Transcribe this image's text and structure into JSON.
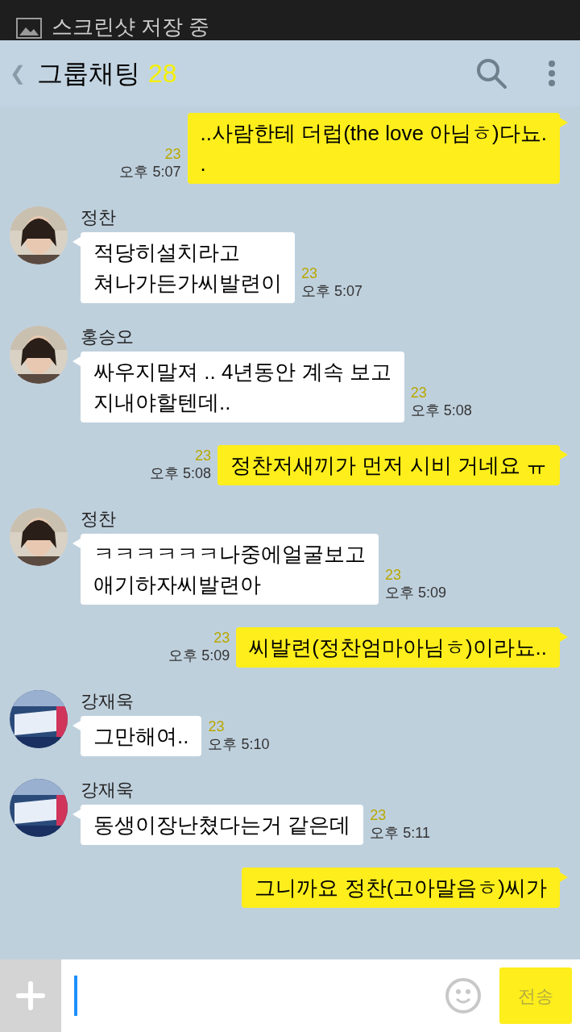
{
  "notification": {
    "text": "스크린샷 저장 중"
  },
  "header": {
    "back": "❮",
    "title": "그룹채팅",
    "member_count": "28"
  },
  "messages": [
    {
      "kind": "sent",
      "lines": [
        "..사람한테 더럽(the love 아님ㅎ)다뇨.",
        "."
      ],
      "unread": "23",
      "time": "오후 5:07"
    },
    {
      "kind": "received",
      "sender": "정찬",
      "avatar": true,
      "lines": [
        "적당히설치라고",
        "쳐나가든가씨발련이"
      ],
      "unread": "23",
      "time": "오후 5:07"
    },
    {
      "kind": "received",
      "sender": "홍승오",
      "avatar": true,
      "lines": [
        "싸우지말져 .. 4년동안 계속 보고",
        "지내야할텐데.."
      ],
      "unread": "23",
      "time": "오후 5:08"
    },
    {
      "kind": "sent",
      "lines": [
        "정찬저새끼가 먼저 시비 거네요 ㅠ"
      ],
      "unread": "23",
      "time": "오후 5:08"
    },
    {
      "kind": "received",
      "sender": "정찬",
      "avatar": true,
      "lines": [
        "ㅋㅋㅋㅋㅋㅋ나중에얼굴보고",
        "애기하자씨발련아"
      ],
      "unread": "23",
      "time": "오후 5:09"
    },
    {
      "kind": "sent",
      "lines": [
        "씨발련(정찬엄마아님ㅎ)이라뇨.."
      ],
      "unread": "23",
      "time": "오후 5:09"
    },
    {
      "kind": "received",
      "sender": "강재욱",
      "avatar": true,
      "lines": [
        "그만해여.."
      ],
      "unread": "23",
      "time": "오후 5:10"
    },
    {
      "kind": "received",
      "sender": "강재욱",
      "avatar": true,
      "lines": [
        "동생이장난쳤다는거 같은데"
      ],
      "unread": "23",
      "time": "오후 5:11"
    },
    {
      "kind": "sent",
      "lines": [
        "그니까요 정찬(고아말음ㅎ)씨가"
      ]
    }
  ],
  "composer": {
    "send": "전송"
  }
}
